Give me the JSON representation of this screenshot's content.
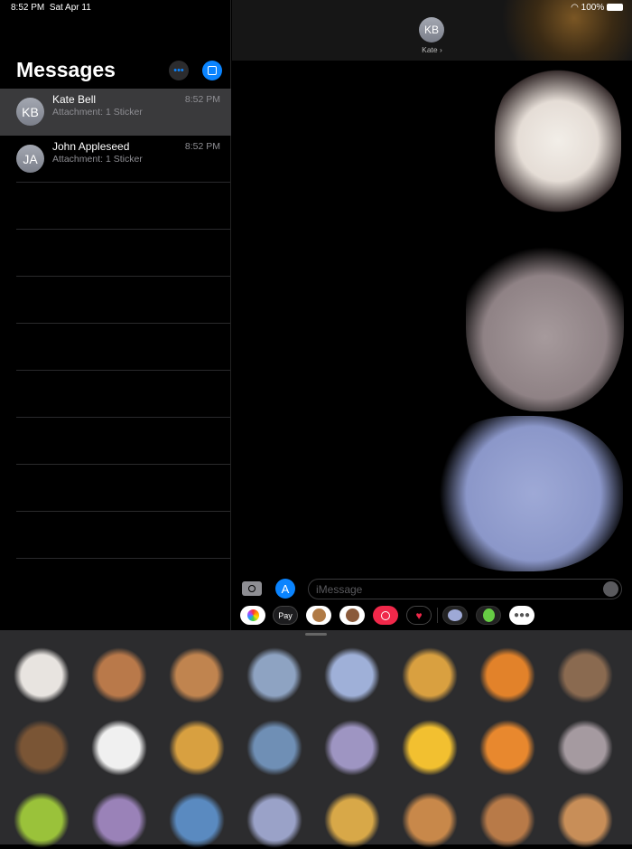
{
  "status": {
    "time": "8:52 PM",
    "date": "Sat Apr 11",
    "battery": "100%"
  },
  "sidebar": {
    "title": "Messages",
    "conversations": [
      {
        "initials": "KB",
        "name": "Kate Bell",
        "preview": "Attachment: 1 Sticker",
        "time": "8:52 PM",
        "selected": true
      },
      {
        "initials": "JA",
        "name": "John Appleseed",
        "preview": "Attachment: 1 Sticker",
        "time": "8:52 PM",
        "selected": false
      }
    ]
  },
  "conversation": {
    "initials": "KB",
    "name": "Kate ›",
    "stickers": [
      "zebra",
      "squirrel",
      "elephant"
    ]
  },
  "composer": {
    "placeholder": "iMessage",
    "apple_pay": "Pay"
  },
  "apps": [
    "photos",
    "apple-pay",
    "animoji",
    "memoji",
    "images-search",
    "digital-touch",
    "elephant-stickers",
    "fairy-stickers",
    "more"
  ],
  "drawer": {
    "stickers": [
      "zebra",
      "monkey-hanging",
      "monkey-hanging-banana",
      "shark",
      "elephant-butterflies",
      "lion",
      "tiger",
      "monkey-juggling",
      "monkey-sitting",
      "cow",
      "giraffe",
      "shark-biting",
      "elephants-pair",
      "lion-cub",
      "tiger-lying",
      "squirrel",
      "snake",
      "hippo",
      "shark-swimming",
      "elephant-baby",
      "lion-standing",
      "monkey-laughing",
      "monkey-surprised",
      "monkey-cute"
    ]
  }
}
